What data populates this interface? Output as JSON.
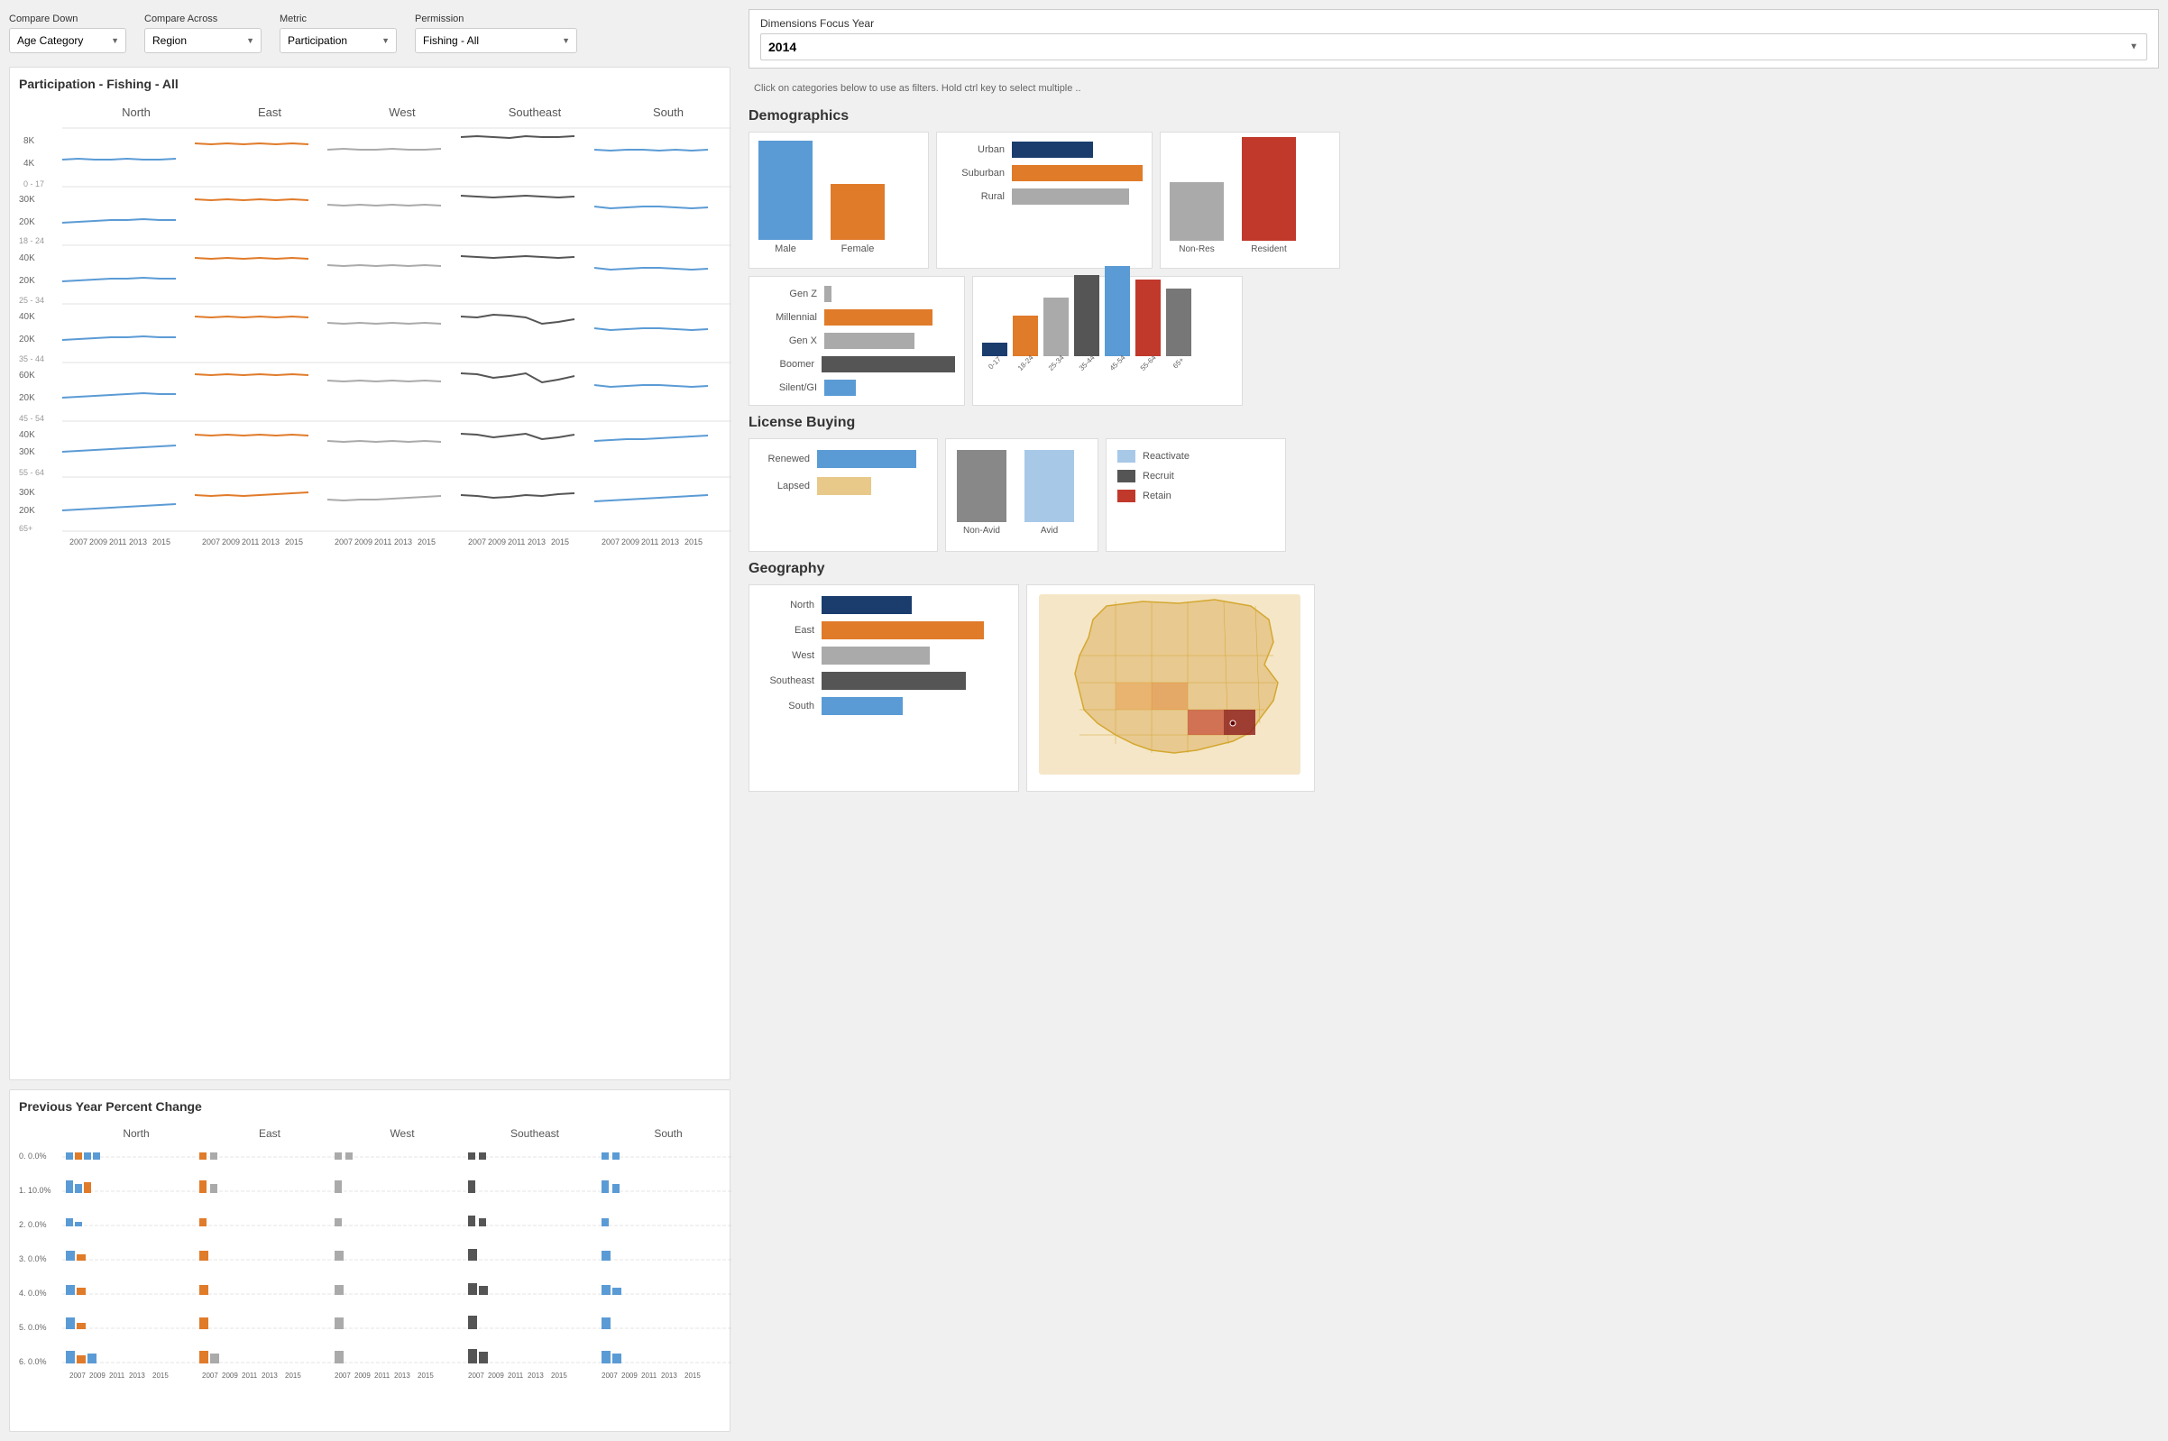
{
  "controls": {
    "compareDown": {
      "label": "Compare Down",
      "value": "Age Category"
    },
    "compareAcross": {
      "label": "Compare Across",
      "value": "Region"
    },
    "metric": {
      "label": "Metric",
      "value": "Participation"
    },
    "permission": {
      "label": "Permission",
      "value": "Fishing - All"
    }
  },
  "dimensionFocus": {
    "label": "Dimensions Focus Year",
    "year": "2014"
  },
  "hint": "Click on categories below to use as filters. Hold ctrl key to select multiple ..",
  "participationChart": {
    "title": "Participation - Fishing - All",
    "regions": [
      "North",
      "East",
      "West",
      "Southeast",
      "South"
    ],
    "ageGroups": [
      "0 - 17",
      "18 - 24",
      "25 - 34",
      "35 - 44",
      "45 - 54",
      "55 - 64",
      "65+"
    ],
    "yLabels": [
      [
        "8K",
        "4K"
      ],
      [
        "30K",
        "20K"
      ],
      [
        "40K",
        "20K"
      ],
      [
        "40K",
        "20K"
      ],
      [
        "60K",
        "20K"
      ],
      [
        "40K",
        "30K"
      ],
      [
        "30K",
        "20K"
      ]
    ]
  },
  "prevYearChart": {
    "title": "Previous Year Percent Change",
    "regions": [
      "North",
      "East",
      "West",
      "Southeast",
      "South"
    ],
    "yLabels": [
      "0.0%",
      "10.0%",
      "0.0%",
      "0.0%",
      "0.0%",
      "0.0%",
      "0.0%"
    ]
  },
  "demographics": {
    "title": "Demographics",
    "gender": {
      "items": [
        {
          "label": "Male",
          "color": "#5b9bd5",
          "height": 100
        },
        {
          "label": "Female",
          "color": "#e07b2a",
          "height": 55
        }
      ]
    },
    "residence": {
      "items": [
        {
          "label": "Urban",
          "color": "#1a3d6e",
          "width": 90
        },
        {
          "label": "Suburban",
          "color": "#e07b2a",
          "width": 150
        },
        {
          "label": "Rural",
          "color": "#aaa",
          "width": 140
        }
      ]
    },
    "residentType": {
      "items": [
        {
          "label": "Non-Res",
          "color": "#aaa",
          "height": 60
        },
        {
          "label": "Resident",
          "color": "#c0392b",
          "height": 110
        }
      ]
    },
    "generation": {
      "items": [
        {
          "label": "Gen Z",
          "color": "#aaa",
          "width": 8
        },
        {
          "label": "Millennial",
          "color": "#e07b2a",
          "width": 120
        },
        {
          "label": "Gen X",
          "color": "#aaa",
          "width": 100
        },
        {
          "label": "Boomer",
          "color": "#555",
          "width": 160
        },
        {
          "label": "Silent/GI",
          "color": "#5b9bd5",
          "width": 35
        }
      ]
    },
    "ageVertical": {
      "items": [
        {
          "label": "0-17",
          "color": "#1a3d6e",
          "height": 15
        },
        {
          "label": "18-24",
          "color": "#e07b2a",
          "height": 45
        },
        {
          "label": "25-34",
          "color": "#aaa",
          "height": 65
        },
        {
          "label": "35-44",
          "color": "#555",
          "height": 90
        },
        {
          "label": "45-54",
          "color": "#5b9bd5",
          "height": 100
        },
        {
          "label": "55-64",
          "color": "#c0392b",
          "height": 85
        },
        {
          "label": "65+",
          "color": "#777",
          "height": 75
        }
      ]
    }
  },
  "licenseBuying": {
    "title": "License Buying",
    "renewedLapsed": {
      "items": [
        {
          "label": "Renewed",
          "color": "#5b9bd5",
          "width": 110
        },
        {
          "label": "Lapsed",
          "color": "#e8c98a",
          "width": 60
        }
      ]
    },
    "avid": {
      "items": [
        {
          "label": "Non-Avid",
          "color": "#888",
          "height": 80
        },
        {
          "label": "Avid",
          "color": "#a8c8e8",
          "height": 80
        }
      ]
    },
    "reactivateRetain": {
      "items": [
        {
          "label": "Reactivate",
          "color": "#a8c8e8",
          "swatch": true
        },
        {
          "label": "Recruit",
          "color": "#555",
          "swatch": true
        },
        {
          "label": "Retain",
          "color": "#c0392b",
          "swatch": true
        }
      ]
    }
  },
  "geography": {
    "title": "Geography",
    "regions": [
      {
        "label": "North",
        "color": "#1a3d6e",
        "width": 100
      },
      {
        "label": "East",
        "color": "#e07b2a",
        "width": 180
      },
      {
        "label": "West",
        "color": "#aaa",
        "width": 120
      },
      {
        "label": "Southeast",
        "color": "#555",
        "width": 160
      },
      {
        "label": "South",
        "color": "#5b9bd5",
        "width": 90
      }
    ]
  },
  "xAxisYears": [
    "2007",
    "2009",
    "2011",
    "2013",
    "2015"
  ]
}
